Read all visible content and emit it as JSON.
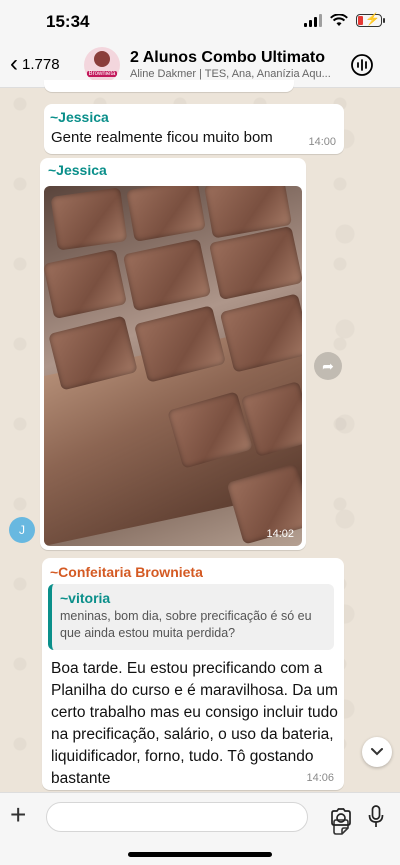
{
  "status_bar": {
    "time": "15:34"
  },
  "header": {
    "back_count": "1.778",
    "group_name": "2 Alunos Combo Ultimato",
    "members": "Aline Dakmer | TES, Ana, Ananízia Aqu...",
    "avatar_badge": "Brownieta"
  },
  "messages": [
    {
      "sender": "~Jessica",
      "text": "Gente realmente  ficou muito bom",
      "time": "14:00"
    },
    {
      "sender": "~Jessica",
      "type": "image",
      "time": "14:02"
    },
    {
      "sender": "~Confeitaria Brownieta",
      "quote": {
        "sender": "~vitoria",
        "text": "meninas, bom dia, sobre precificação é só eu que ainda estou muita perdida?"
      },
      "text": "Boa tarde. Eu estou precificando com a Planilha do curso e é maravilhosa. Da um certo trabalho mas eu consigo incluir tudo na precificação, salário, o uso da bateria, liquidificador, forno, tudo. Tô gostando bastante",
      "time": "14:06"
    }
  ],
  "avatar_initial": "J",
  "colors": {
    "sender_teal": "#0a8f8a",
    "sender_orange": "#d45a23",
    "battery_low": "#e53935"
  },
  "icons": [
    "chevron-left-icon",
    "call-waveform-icon",
    "forward-icon",
    "chevron-down-icon",
    "plus-icon",
    "sticker-icon",
    "camera-icon",
    "microphone-icon"
  ]
}
